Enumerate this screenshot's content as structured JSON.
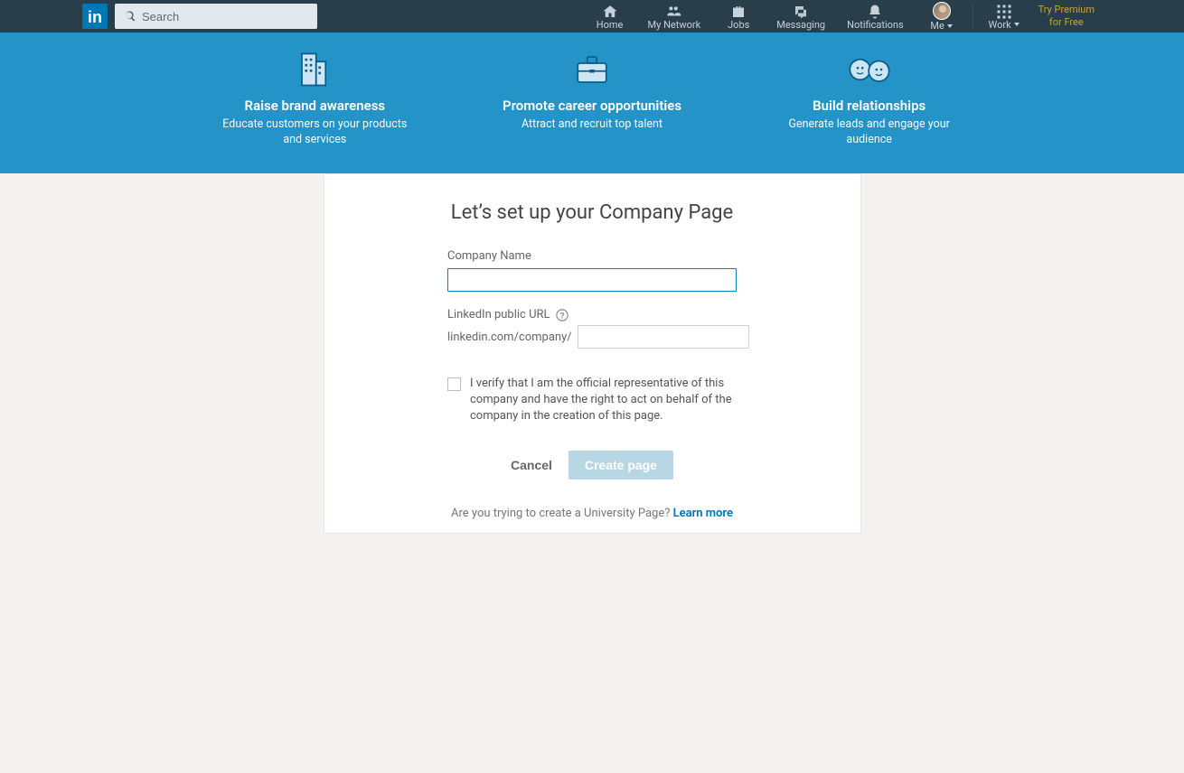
{
  "nav": {
    "search_placeholder": "Search",
    "items": {
      "home": "Home",
      "network": "My Network",
      "jobs": "Jobs",
      "messaging": "Messaging",
      "notifications": "Notifications",
      "me": "Me",
      "work": "Work"
    },
    "premium_line1": "Try Premium",
    "premium_line2": "for Free"
  },
  "hero": {
    "brand": {
      "title": "Raise brand awareness",
      "desc": "Educate customers on your products and services"
    },
    "career": {
      "title": "Promote career opportunities",
      "desc": "Attract and recruit top talent"
    },
    "relationships": {
      "title": "Build relationships",
      "desc": "Generate leads and engage your audience"
    }
  },
  "card": {
    "title": "Let’s set up your Company Page",
    "company_name_label": "Company Name",
    "company_name_value": "",
    "url_label": "LinkedIn public URL",
    "url_prefix": "linkedin.com/company/",
    "url_value": "",
    "verify_text": "I verify that I am the official representative of this company and have the right to act on behalf of the company in the creation of this page.",
    "cancel": "Cancel",
    "create": "Create page",
    "footer_question": "Are you trying to create a University Page? ",
    "footer_link": "Learn more"
  }
}
